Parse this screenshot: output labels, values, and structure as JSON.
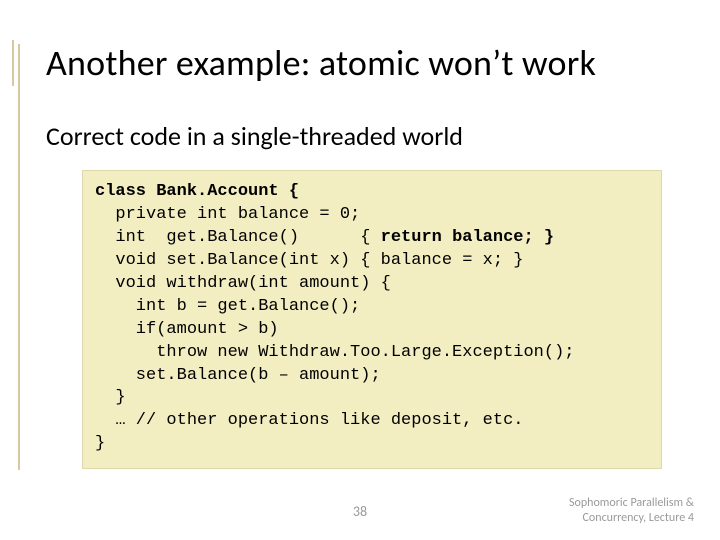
{
  "title": "Another example: atomic won’t work",
  "subtitle": "Correct code in a single-threaded world",
  "code": {
    "l01a": "class",
    "l01b": " Bank.Account {",
    "l02": "  private int balance = 0;",
    "l03a": "  int  get.Balance()      { ",
    "l03b": "return",
    "l03c": " balance; }",
    "l04": "  void set.Balance(int x) { balance = x; }",
    "l05": "  void withdraw(int amount) {",
    "l06": "    int b = get.Balance();",
    "l07": "    if(amount > b)",
    "l08": "      throw new Withdraw.Too.Large.Exception();",
    "l09": "    set.Balance(b – amount);",
    "l10": "  }",
    "l11": "  … // other operations like deposit, etc.",
    "l12": "}"
  },
  "page_number": "38",
  "footer_line1": "Sophomoric Parallelism &",
  "footer_line2": "Concurrency, Lecture 4"
}
